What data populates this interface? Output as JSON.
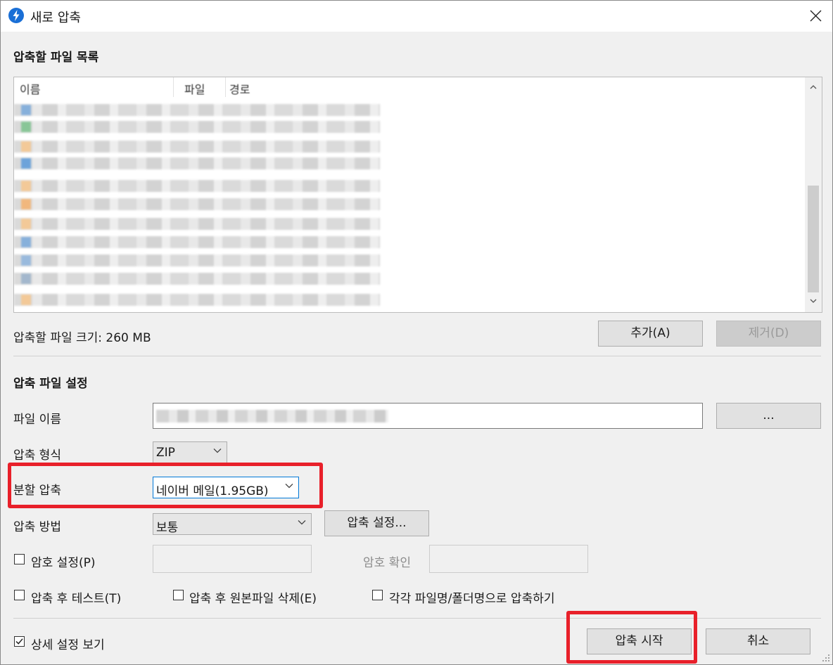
{
  "window": {
    "title": "새로 압축",
    "accent": "#1a6fd6",
    "highlight_color": "#e8202a"
  },
  "file_list_section": {
    "title": "압축할 파일 목록",
    "columns": [
      "이름",
      "파일",
      "경로"
    ],
    "size_text": "압축할 파일 크기: 260 MB",
    "add_button": "추가(A)",
    "remove_button": "제거(D)"
  },
  "settings_section": {
    "title": "압축 파일 설정",
    "filename_label": "파일 이름",
    "browse_button": "...",
    "format_label": "압축 형식",
    "format_value": "ZIP",
    "split_label": "분할 압축",
    "split_value": "네이버 메일(1.95GB)",
    "method_label": "압축 방법",
    "method_value": "보통",
    "method_settings_button": "압축 설정...",
    "password_checkbox": "암호 설정(P)",
    "password_confirm_label": "암호 확인",
    "test_checkbox": "압축 후 테스트(T)",
    "delete_checkbox": "압축 후 원본파일 삭제(E)",
    "each_checkbox": "각각 파일명/폴더명으로 압축하기"
  },
  "footer": {
    "details_checkbox": "상세 설정 보기",
    "details_checked": true,
    "start_button": "압축 시작",
    "cancel_button": "취소"
  }
}
